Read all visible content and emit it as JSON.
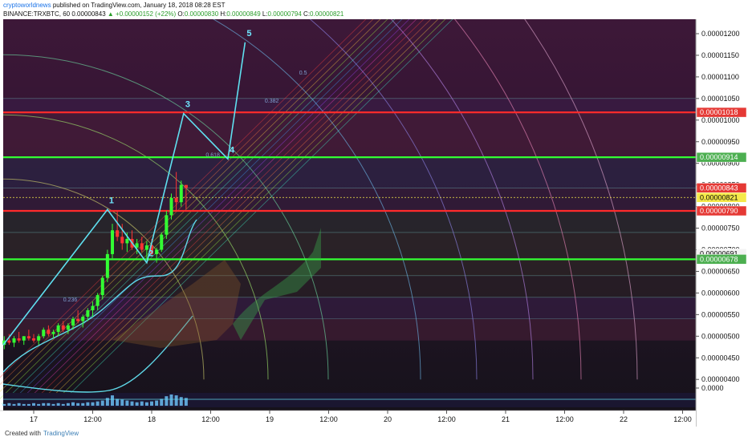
{
  "header": {
    "author": "cryptoworldnews",
    "published_text": "published on TradingView.com, January 18, 2018 08:28 EST",
    "symbol": "BINANCE:TRXBTC, 60",
    "last": "0.00000843",
    "change": "▲ +0.00000152 (+22%)",
    "ohlc": {
      "o_label": "O:",
      "o": "0.00000830",
      "h_label": "H:",
      "h": "0.00000849",
      "l_label": "L:",
      "l": "0.00000794",
      "c_label": "C:",
      "c": "0.00000821"
    }
  },
  "footer": {
    "created_with": "Created with",
    "brand": "TradingView"
  },
  "chart_data": {
    "type": "candlestick",
    "symbol": "TRXBTC",
    "interval": "60",
    "ylim": [
      3.6e-06,
      1.25e-05
    ],
    "y_ticks": [
      "0.00001200",
      "0.00001150",
      "0.00001100",
      "0.00001050",
      "0.00001000",
      "0.00000950",
      "0.00000900",
      "0.00000850",
      "0.00000800",
      "0.00000750",
      "0.00000700",
      "0.00000650",
      "0.00000600",
      "0.00000550",
      "0.00000500",
      "0.00000450",
      "0.00000400",
      "0.0000"
    ],
    "y_tick_values": [
      1200,
      1150,
      1100,
      1050,
      1000,
      950,
      900,
      850,
      800,
      750,
      700,
      650,
      600,
      550,
      500,
      450,
      400,
      380
    ],
    "x_ticks": [
      {
        "label": "17",
        "t": 8
      },
      {
        "label": "12:00",
        "t": 20
      },
      {
        "label": "18",
        "t": 32
      },
      {
        "label": "12:00",
        "t": 44
      },
      {
        "label": "19",
        "t": 56
      },
      {
        "label": "12:00",
        "t": 68
      },
      {
        "label": "20",
        "t": 80
      },
      {
        "label": "12:00",
        "t": 92
      },
      {
        "label": "21",
        "t": 104
      },
      {
        "label": "12:00",
        "t": 116
      },
      {
        "label": "22",
        "t": 128
      },
      {
        "label": "12:00",
        "t": 140
      }
    ],
    "price_labels": [
      {
        "value": "0.00001018",
        "y": 1018,
        "color": "#e53935",
        "text_color": "#ffffff"
      },
      {
        "value": "0.00000914",
        "y": 914,
        "color": "#4caf50",
        "text_color": "#ffffff"
      },
      {
        "value": "0.00000843",
        "y": 843,
        "color": "#e53935",
        "text_color": "#ffffff"
      },
      {
        "value": "0.00000821",
        "y": 821,
        "color": "#f5e94a",
        "text_color": "#000000"
      },
      {
        "value": "0.00000790",
        "y": 790,
        "color": "#e53935",
        "text_color": "#ffffff"
      },
      {
        "value": "0.00000691",
        "y": 691,
        "color": "#f2f2f2",
        "text_color": "#000000"
      },
      {
        "value": "0.00000678",
        "y": 678,
        "color": "#4caf50",
        "text_color": "#ffffff"
      }
    ],
    "horizontal_lines": [
      {
        "y": 1018,
        "color": "#ff2b2b"
      },
      {
        "y": 914,
        "color": "#33ff33"
      },
      {
        "y": 790,
        "color": "#ff2b2b"
      },
      {
        "y": 678,
        "color": "#33ff33"
      }
    ],
    "waves": [
      {
        "label": "1",
        "t": 23,
        "y": 793
      },
      {
        "label": "2",
        "t": 31,
        "y": 670
      },
      {
        "label": "3",
        "t": 38.5,
        "y": 1015
      },
      {
        "label": "4",
        "t": 47.5,
        "y": 910
      },
      {
        "label": "5",
        "t": 51,
        "y": 1180
      }
    ],
    "fib_labels": [
      {
        "text": "0.618",
        "t": 43,
        "y": 915
      },
      {
        "text": "0.382",
        "t": 55,
        "y": 1040
      },
      {
        "text": "0.5",
        "t": 62,
        "y": 1105
      },
      {
        "text": "0.236",
        "t": 14,
        "y": 580
      }
    ],
    "candles": [
      [
        0,
        480,
        500,
        470,
        490
      ],
      [
        1,
        490,
        505,
        480,
        485
      ],
      [
        2,
        485,
        500,
        475,
        495
      ],
      [
        3,
        495,
        510,
        485,
        490
      ],
      [
        4,
        490,
        500,
        480,
        500
      ],
      [
        5,
        500,
        515,
        490,
        495
      ],
      [
        6,
        495,
        505,
        485,
        490
      ],
      [
        7,
        490,
        505,
        480,
        500
      ],
      [
        8,
        500,
        520,
        495,
        515
      ],
      [
        9,
        515,
        525,
        500,
        505
      ],
      [
        10,
        505,
        515,
        495,
        510
      ],
      [
        11,
        510,
        530,
        500,
        525
      ],
      [
        12,
        525,
        535,
        510,
        515
      ],
      [
        13,
        515,
        530,
        505,
        525
      ],
      [
        14,
        525,
        545,
        515,
        540
      ],
      [
        15,
        540,
        560,
        530,
        535
      ],
      [
        16,
        535,
        550,
        520,
        545
      ],
      [
        17,
        545,
        565,
        535,
        560
      ],
      [
        18,
        560,
        580,
        545,
        570
      ],
      [
        19,
        570,
        600,
        560,
        595
      ],
      [
        20,
        595,
        640,
        585,
        635
      ],
      [
        21,
        635,
        700,
        625,
        690
      ],
      [
        22,
        690,
        760,
        680,
        745
      ],
      [
        23,
        745,
        790,
        720,
        730
      ],
      [
        24,
        730,
        760,
        700,
        715
      ],
      [
        25,
        715,
        740,
        695,
        725
      ],
      [
        26,
        725,
        745,
        700,
        705
      ],
      [
        27,
        705,
        725,
        690,
        715
      ],
      [
        28,
        715,
        730,
        695,
        700
      ],
      [
        29,
        700,
        720,
        680,
        710
      ],
      [
        30,
        710,
        725,
        685,
        690
      ],
      [
        31,
        690,
        705,
        670,
        700
      ],
      [
        32,
        700,
        740,
        695,
        735
      ],
      [
        33,
        735,
        790,
        725,
        780
      ],
      [
        34,
        780,
        830,
        770,
        820
      ],
      [
        35,
        820,
        880,
        790,
        810
      ],
      [
        36,
        810,
        860,
        800,
        850
      ],
      [
        37,
        850,
        849,
        794,
        843
      ]
    ],
    "volume": [
      2,
      3,
      2,
      3,
      2,
      2,
      3,
      2,
      3,
      3,
      2,
      3,
      2,
      3,
      4,
      3,
      3,
      4,
      4,
      5,
      6,
      9,
      12,
      8,
      7,
      6,
      5,
      4,
      5,
      4,
      5,
      6,
      8,
      11,
      13,
      12,
      10,
      9
    ]
  }
}
